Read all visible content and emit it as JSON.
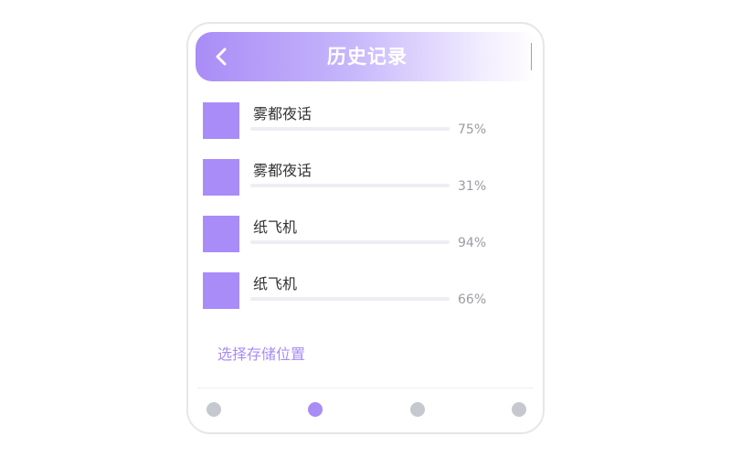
{
  "header": {
    "title": "历史记录",
    "back_icon": "chevron-left-icon",
    "gradient_start": "#a98cf6",
    "gradient_end": "#ffffff"
  },
  "history": {
    "items": [
      {
        "title": "雾都夜话",
        "progress": 75,
        "progress_label": "75%"
      },
      {
        "title": "雾都夜话",
        "progress": 31,
        "progress_label": "31%"
      },
      {
        "title": "纸飞机",
        "progress": 94,
        "progress_label": "94%"
      },
      {
        "title": "纸飞机",
        "progress": 66,
        "progress_label": "66%"
      }
    ]
  },
  "storage": {
    "link_label": "选择存储位置"
  },
  "pagination": {
    "count": 4,
    "active_index": 1
  },
  "colors": {
    "accent": "#a98cf6",
    "thumb": "#a98cf8",
    "dot_inactive": "#c5c8cf"
  }
}
